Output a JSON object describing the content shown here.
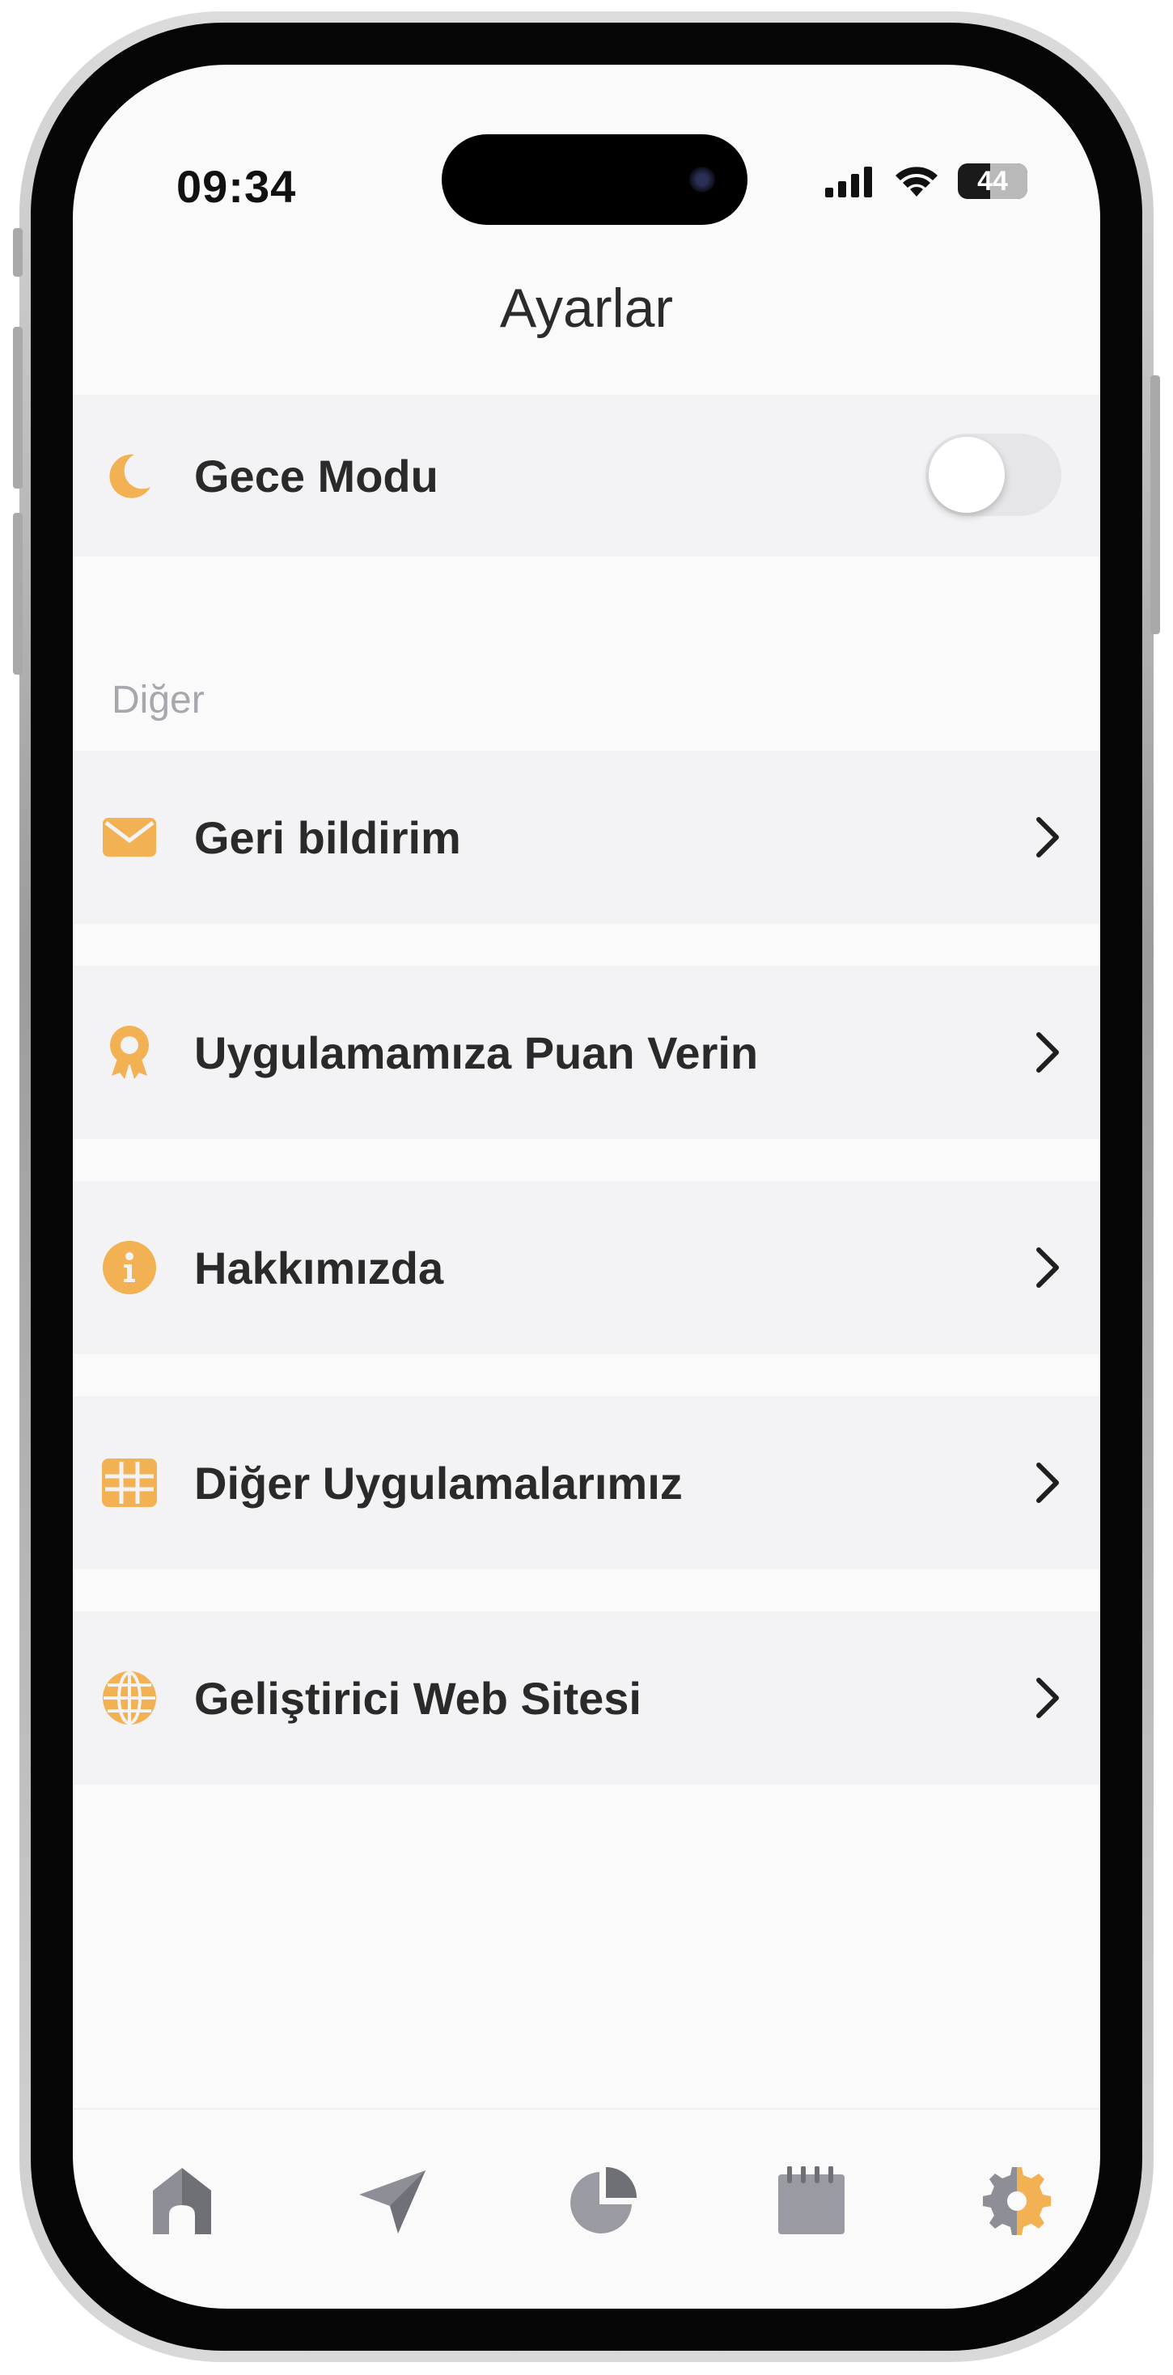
{
  "status_bar": {
    "time": "09:34",
    "battery_level": "44"
  },
  "header": {
    "title": "Ayarlar"
  },
  "night_mode": {
    "label": "Gece Modu",
    "enabled": false
  },
  "section": {
    "other_label": "Diğer"
  },
  "menu": [
    {
      "label": "Geri bildirim",
      "icon": "envelope-icon"
    },
    {
      "label": "Uygulamamıza Puan Verin",
      "icon": "award-icon"
    },
    {
      "label": "Hakkımızda",
      "icon": "info-icon"
    },
    {
      "label": "Diğer Uygulamalarımız",
      "icon": "grid-icon"
    },
    {
      "label": "Geliştirici Web Sitesi",
      "icon": "globe-icon"
    }
  ],
  "tabbar": {
    "items": [
      "home-icon",
      "send-icon",
      "pie-chart-icon",
      "notepad-icon",
      "settings-gear-icon"
    ],
    "active": "settings"
  },
  "colors": {
    "accent": "#F2B254",
    "inactive_tab": "#8E8E96",
    "row_bg": "#F3F3F5"
  }
}
